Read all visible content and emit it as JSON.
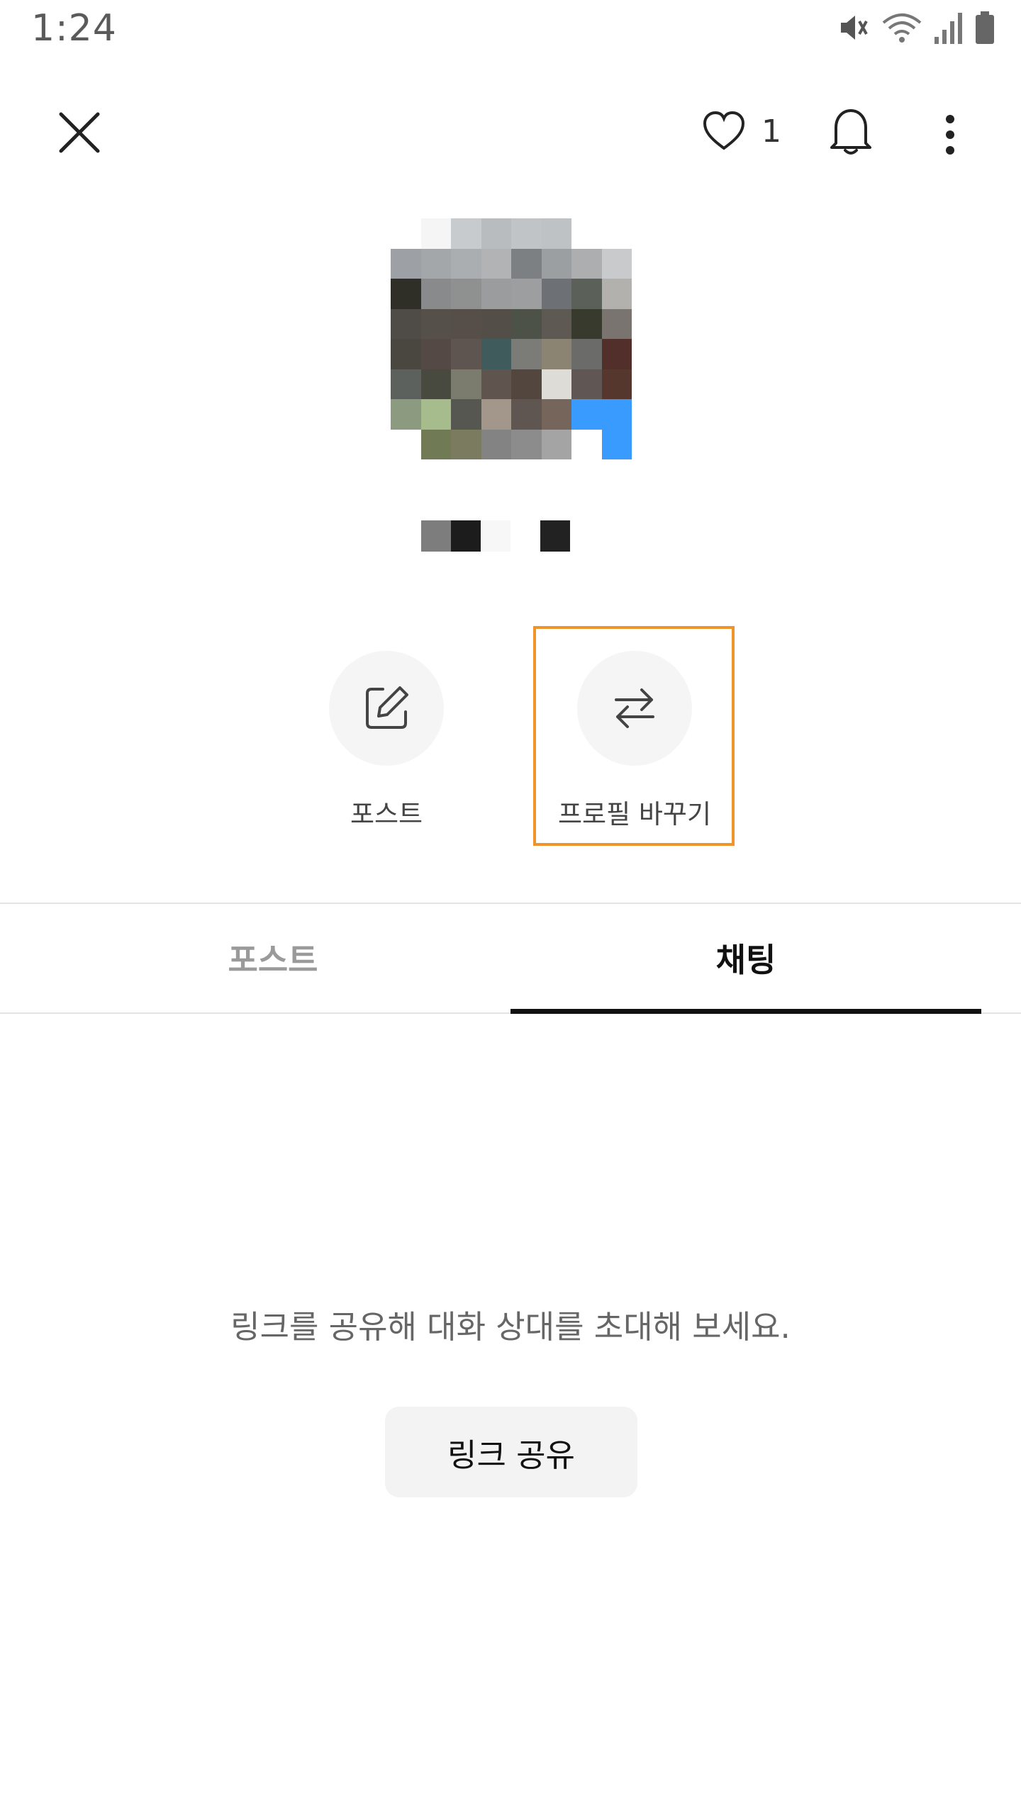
{
  "status_bar": {
    "time": "1:24",
    "icons": [
      "mute-icon",
      "wifi-icon",
      "signal-icon",
      "battery-icon"
    ]
  },
  "top_bar": {
    "close_icon": "close-icon",
    "like_icon": "heart-icon",
    "like_count": "1",
    "bell_icon": "bell-icon",
    "more_icon": "more-vertical-icon"
  },
  "profile": {
    "avatar_mosaic": [
      "#ffffff",
      "#f5f5f5",
      "#c8cbcd",
      "#b9bcbf",
      "#c1c4c6",
      "#bfc2c4",
      "#ffffff",
      "#ffffff",
      "#9da1a5",
      "#a4a7aa",
      "#abaeb1",
      "#b1b3b5",
      "#7c8083",
      "#9c9fa2",
      "#acaeb0",
      "#c9cacb",
      "#2f2f28",
      "#888a8b",
      "#8f9191",
      "#9a9c9e",
      "#9c9ea0",
      "#6d7175",
      "#5b6159",
      "#b3b1ae",
      "#4f4b46",
      "#56504b",
      "#554e49",
      "#544e49",
      "#4c5248",
      "#5f5953",
      "#373a2c",
      "#7a7470",
      "#4a4740",
      "#544944",
      "#5e5550",
      "#3f5b5b",
      "#7b7c78",
      "#8c8472",
      "#6b6c69",
      "#522f2b",
      "#5c615d",
      "#484a3f",
      "#7b7c6d",
      "#5f554e",
      "#53463f",
      "#dedcd6",
      "#605653",
      "#56372e",
      "#8c9b7f",
      "#a6bc8c",
      "#575751",
      "#a3968a",
      "#5f5651",
      "#75655a",
      "#3a9bff",
      "#3a9bff",
      "#ffffff",
      "#707b55",
      "#7b7c5f",
      "#838383",
      "#8c8c8c",
      "#a4a4a4",
      "#ffffff",
      "#3a9bff"
    ],
    "name_mosaic": [
      "#7d7d7d",
      "#1c1c1c",
      "#f7f7f7",
      "#ffffff",
      "#222222"
    ]
  },
  "actions": [
    {
      "icon": "edit-icon",
      "label": "포스트"
    },
    {
      "icon": "swap-arrows-icon",
      "label": "프로필 바꾸기"
    }
  ],
  "highlight_color": "#f0932b",
  "tabs": [
    {
      "label": "포스트",
      "selected": false
    },
    {
      "label": "채팅",
      "selected": true
    }
  ],
  "empty_state": {
    "message": "링크를 공유해 대화 상대를 초대해 보세요.",
    "button_label": "링크 공유"
  }
}
